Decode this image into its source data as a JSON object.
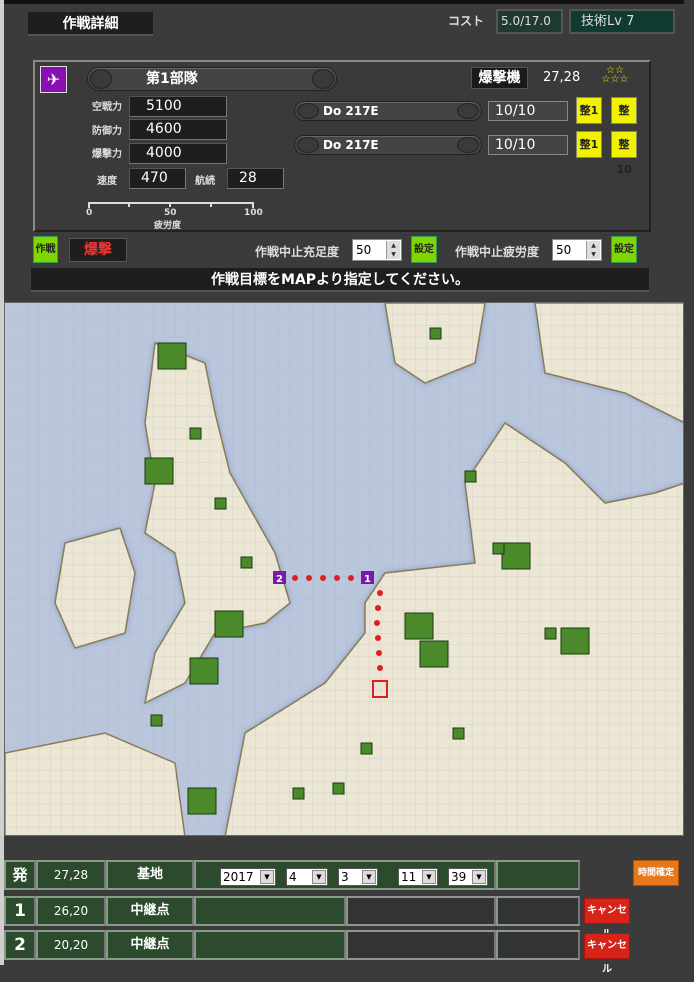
{
  "header": {
    "title": "作戦詳細",
    "cost_label": "コスト",
    "cost_value": "5.0/17.0",
    "tech_level": "技術Lv 7"
  },
  "unit": {
    "icon": "plane-icon",
    "name": "第1部隊",
    "type": "爆撃機",
    "base_coord": "27,28",
    "rank_stars": "☆☆☆☆☆",
    "stats": {
      "air_label": "空戦力",
      "air": "5100",
      "def_label": "防御力",
      "def": "4600",
      "bomb_label": "爆撃力",
      "bomb": "4000",
      "speed_label": "速度",
      "speed": "470",
      "range_label": "航続",
      "range": "28"
    },
    "fatigue": {
      "label": "疲労度",
      "ticks": [
        "0",
        "50",
        "100"
      ],
      "value": 0
    },
    "aircraft": [
      {
        "name": "Do 217E",
        "count": "10/10",
        "btn1": "整1",
        "btn10": "整10"
      },
      {
        "name": "Do 217E",
        "count": "10/10",
        "btn1": "整1",
        "btn10": "整10"
      }
    ]
  },
  "controls": {
    "op_button": "作戦",
    "mode": "爆撃",
    "abort_satisfaction_label": "作戦中止充足度",
    "abort_satisfaction": "50",
    "abort_fatigue_label": "作戦中止疲労度",
    "abort_fatigue": "50",
    "set_label": "設定"
  },
  "message": "作戦目標をMAPより指定してください。",
  "map": {
    "route_labels": [
      "1",
      "2"
    ],
    "colors": {
      "sea": "#b9c6dc",
      "land": "#ece6d4",
      "route": "#e02020",
      "waypoint": "#7a1aa8"
    }
  },
  "table": {
    "confirm_time": "時間確定",
    "cancel": "キャンセル",
    "rows": [
      {
        "id": "発",
        "coord": "27,28",
        "kind": "基地",
        "year": "2017",
        "month": "4",
        "day": "3",
        "hour": "11",
        "minute": "39"
      },
      {
        "id": "1",
        "coord": "26,20",
        "kind": "中継点"
      },
      {
        "id": "2",
        "coord": "20,20",
        "kind": "中継点"
      }
    ]
  }
}
